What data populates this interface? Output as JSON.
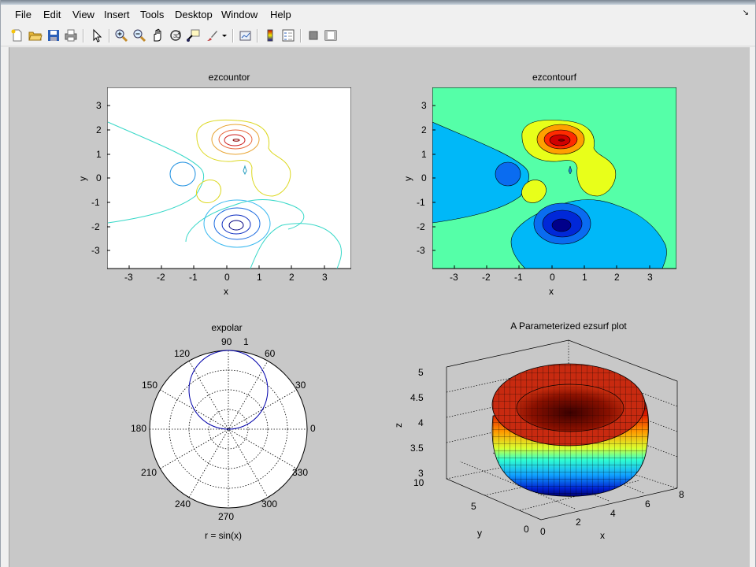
{
  "menu": {
    "file": "File",
    "edit": "Edit",
    "view": "View",
    "insert": "Insert",
    "tools": "Tools",
    "desktop": "Desktop",
    "window": "Window",
    "help": "Help",
    "corner": "↘"
  },
  "toolbar": {
    "icons": [
      "new-file-icon",
      "open-folder-icon",
      "save-icon",
      "print-icon",
      "pointer-icon",
      "zoom-in-icon",
      "zoom-out-icon",
      "pan-icon",
      "rotate-3d-icon",
      "data-cursor-icon",
      "brush-icon",
      "brush-dropdown-icon",
      "link-plot-icon",
      "insert-colorbar-icon",
      "insert-legend-icon",
      "hide-plot-tools-icon",
      "show-plot-tools-icon"
    ]
  },
  "plots": {
    "contour": {
      "title": "ezcountor",
      "xlabel": "x",
      "ylabel": "y",
      "xticks": [
        "-3",
        "-2",
        "-1",
        "0",
        "1",
        "2",
        "3"
      ],
      "yticks": [
        "3",
        "2",
        "1",
        "0",
        "-1",
        "-2",
        "-3"
      ]
    },
    "contourf": {
      "title": "ezcontourf",
      "xlabel": "x",
      "ylabel": "y",
      "xticks": [
        "-3",
        "-2",
        "-1",
        "0",
        "1",
        "2",
        "3"
      ],
      "yticks": [
        "3",
        "2",
        "1",
        "0",
        "-1",
        "-2",
        "-3"
      ]
    },
    "polar": {
      "title": "expolar",
      "xlabel": "r = sin(x)",
      "angles": [
        "90",
        "60",
        "30",
        "0",
        "330",
        "300",
        "270",
        "240",
        "210",
        "180",
        "150",
        "120"
      ],
      "rlabel": "1"
    },
    "surf": {
      "title": "A Parameterized ezsurf plot",
      "xlabel": "x",
      "ylabel": "y",
      "zlabel": "z",
      "zticks": [
        "5",
        "4.5",
        "4",
        "3.5",
        "3"
      ],
      "xticks": [
        "0",
        "2",
        "4",
        "6",
        "8"
      ],
      "yticks": [
        "10",
        "5",
        "0"
      ]
    }
  },
  "colors": {
    "contourf_background": "#55ffa8",
    "polar_line": "#0000aa",
    "figure_background": "#c8c8c8"
  }
}
